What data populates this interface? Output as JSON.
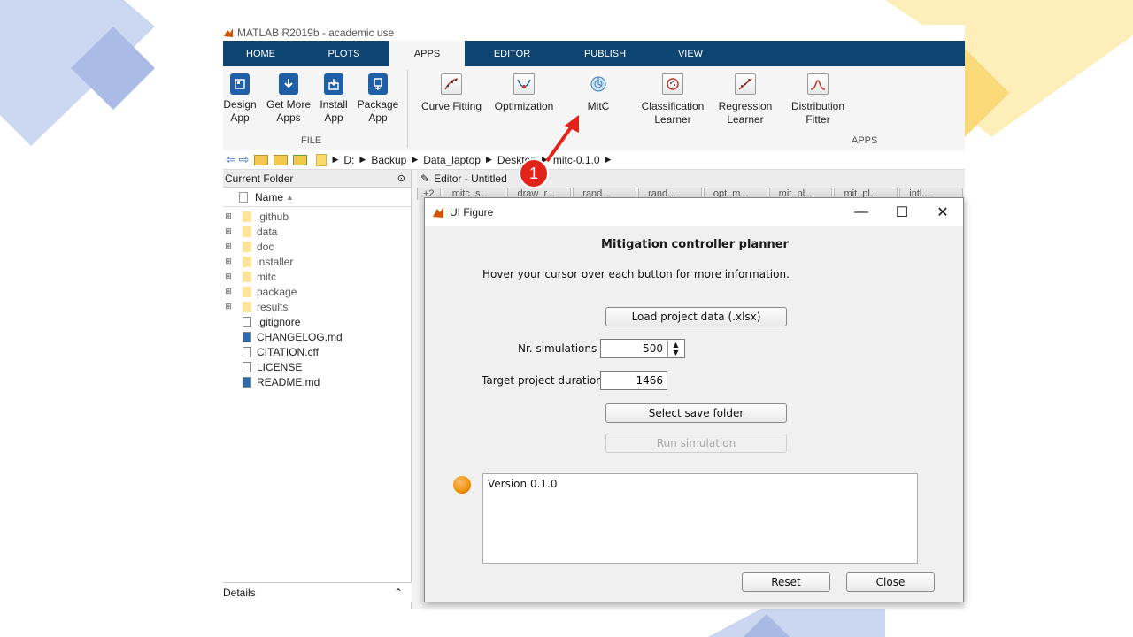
{
  "window_title": "MATLAB R2019b - academic use",
  "tabs": [
    "HOME",
    "PLOTS",
    "APPS",
    "EDITOR",
    "PUBLISH",
    "VIEW"
  ],
  "file_section": {
    "label": "FILE",
    "buttons": [
      {
        "line1": "Design",
        "line2": "App"
      },
      {
        "line1": "Get More",
        "line2": "Apps"
      },
      {
        "line1": "Install",
        "line2": "App"
      },
      {
        "line1": "Package",
        "line2": "App"
      }
    ]
  },
  "apps_section": {
    "label": "APPS",
    "apps": [
      {
        "line1": "Curve Fitting",
        "line2": ""
      },
      {
        "line1": "Optimization",
        "line2": ""
      },
      {
        "line1": "MitC",
        "line2": ""
      },
      {
        "line1": "Classification",
        "line2": "Learner"
      },
      {
        "line1": "Regression",
        "line2": "Learner"
      },
      {
        "line1": "Distribution",
        "line2": "Fitter"
      }
    ]
  },
  "path": [
    "D:",
    "Backup",
    "Data_laptop",
    "Desktop",
    "mitc-0.1.0"
  ],
  "current_folder": {
    "title": "Current Folder",
    "column": "Name",
    "sort_indicator": "▲",
    "items": [
      {
        "name": ".github",
        "type": "folder"
      },
      {
        "name": "data",
        "type": "folder"
      },
      {
        "name": "doc",
        "type": "folder"
      },
      {
        "name": "installer",
        "type": "folder"
      },
      {
        "name": "mitc",
        "type": "folder"
      },
      {
        "name": "package",
        "type": "folder"
      },
      {
        "name": "results",
        "type": "folder"
      },
      {
        "name": ".gitignore",
        "type": "file"
      },
      {
        "name": "CHANGELOG.md",
        "type": "md"
      },
      {
        "name": "CITATION.cff",
        "type": "file"
      },
      {
        "name": "LICENSE",
        "type": "file"
      },
      {
        "name": "README.md",
        "type": "md"
      }
    ],
    "details_label": "Details"
  },
  "editor": {
    "title": "Editor - Untitled",
    "tabs": [
      "+2",
      "mitc_s...",
      "draw_r...",
      "rand...",
      "rand...",
      "opt_m...",
      "mit_pl...",
      "mit_pl...",
      "intl..."
    ]
  },
  "callout": {
    "number": "1"
  },
  "ui_figure": {
    "title": "UI Figure",
    "heading": "Mitigation controller planner",
    "hint": "Hover your cursor over each button for more information.",
    "load_button": "Load project data (.xlsx)",
    "nr_sim_label": "Nr. simulations",
    "nr_sim_value": "500",
    "duration_label": "Target project duration",
    "duration_value": "1466",
    "save_folder_button": "Select save folder",
    "run_button": "Run simulation",
    "status_color": "#f0900a",
    "log_text": "Version 0.1.0",
    "reset_button": "Reset",
    "close_button": "Close"
  },
  "colors": {
    "tab_bar": "#0d4472",
    "deco_blue": "#c9d5f0",
    "deco_yellow": "#fbe8a6",
    "callout_red": "#e2231a"
  }
}
